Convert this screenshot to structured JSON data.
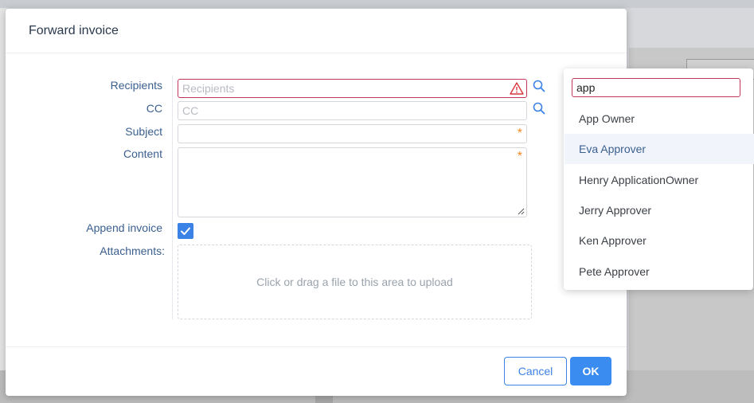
{
  "dialog": {
    "title": "Forward invoice",
    "labels": {
      "recipients": "Recipients",
      "cc": "CC",
      "subject": "Subject",
      "content": "Content",
      "append_invoice": "Append invoice",
      "attachments": "Attachments:"
    },
    "placeholders": {
      "recipients": "Recipients",
      "cc": "CC"
    },
    "subject_value": "",
    "content_value": "",
    "append_invoice_checked": true,
    "upload_text": "Click or drag a file to this area to upload",
    "required_mark": "*",
    "buttons": {
      "cancel": "Cancel",
      "ok": "OK"
    }
  },
  "recipient_search": {
    "query": "app",
    "results": [
      {
        "name": "App Owner",
        "highlighted": false
      },
      {
        "name": "Eva Approver",
        "highlighted": true
      },
      {
        "name": "Henry ApplicationOwner",
        "highlighted": false
      },
      {
        "name": "Jerry Approver",
        "highlighted": false
      },
      {
        "name": "Ken Approver",
        "highlighted": false
      },
      {
        "name": "Pete Approver",
        "highlighted": false
      }
    ]
  },
  "icons": {
    "recipients_search": "search-icon",
    "cc_search": "search-icon",
    "recipients_warning": "warning-icon",
    "append_checkbox": "checkmark-icon"
  },
  "colors": {
    "accent": "#3b82e6",
    "error": "#c2385a",
    "required": "#f08a24",
    "label": "#3a5f8f"
  }
}
